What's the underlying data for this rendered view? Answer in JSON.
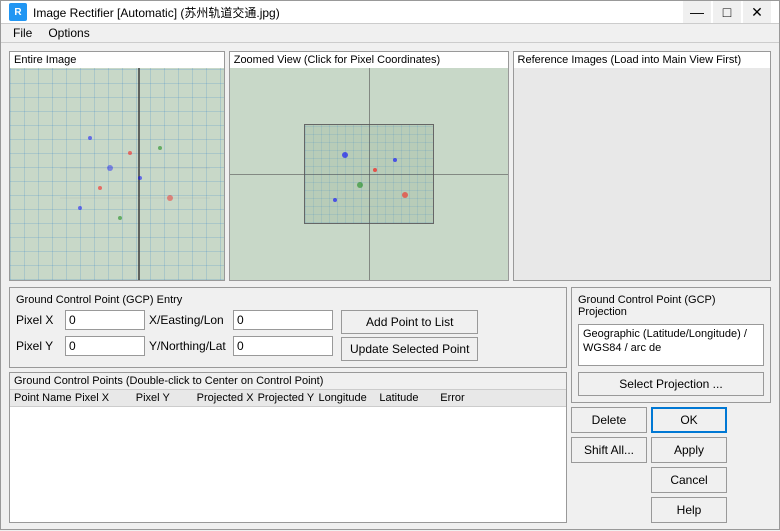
{
  "window": {
    "title": "Image Rectifier [Automatic] (苏州轨道交通.jpg)",
    "icon": "R"
  },
  "menu": {
    "items": [
      "File",
      "Options"
    ]
  },
  "panels": {
    "entire_image": "Entire Image",
    "zoomed_view": "Zoomed View (Click for Pixel Coordinates)",
    "reference_images": "Reference Images (Load into Main View First)"
  },
  "gcp_entry": {
    "title": "Ground Control Point (GCP) Entry",
    "pixel_x_label": "Pixel X",
    "pixel_x_value": "0",
    "x_easting_label": "X/Easting/Lon",
    "x_easting_value": "0",
    "pixel_y_label": "Pixel Y",
    "pixel_y_value": "0",
    "y_northing_label": "Y/Northing/Lat",
    "y_northing_value": "0",
    "add_point_label": "Add Point to List",
    "update_point_label": "Update Selected Point"
  },
  "gcp_table": {
    "title": "Ground Control Points (Double-click to Center on Control Point)",
    "columns": [
      "Point Name",
      "Pixel X",
      "Pixel Y",
      "Projected X",
      "Projected Y",
      "Longitude",
      "Latitude",
      "Error"
    ]
  },
  "gcp_projection": {
    "title": "Ground Control Point (GCP) Projection",
    "projection_text": "Geographic (Latitude/Longitude) / WGS84 / arc de",
    "select_projection_label": "Select Projection ..."
  },
  "buttons": {
    "delete": "Delete",
    "shift_all": "Shift All...",
    "ok": "OK",
    "apply": "Apply",
    "cancel": "Cancel",
    "help": "Help"
  },
  "title_controls": {
    "minimize": "—",
    "maximize": "□",
    "close": "✕"
  }
}
